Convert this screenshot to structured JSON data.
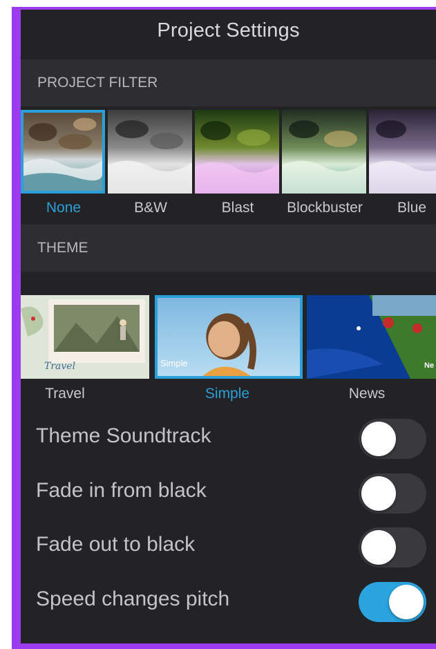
{
  "header": {
    "title": "Project Settings"
  },
  "project_filter": {
    "section_title": "PROJECT FILTER",
    "filters": [
      {
        "label": "None",
        "selected": true
      },
      {
        "label": "B&W",
        "selected": false
      },
      {
        "label": "Blast",
        "selected": false
      },
      {
        "label": "Blockbuster",
        "selected": false
      },
      {
        "label": "Blue",
        "selected": false
      }
    ]
  },
  "theme": {
    "section_title": "THEME",
    "themes": [
      {
        "label": "Travel",
        "selected": false,
        "thumb_text": "Travel"
      },
      {
        "label": "Simple",
        "selected": true,
        "thumb_text": "Simple"
      },
      {
        "label": "News",
        "selected": false,
        "thumb_text": "Ne"
      }
    ]
  },
  "settings": [
    {
      "label": "Theme Soundtrack",
      "on": false
    },
    {
      "label": "Fade in from black",
      "on": false
    },
    {
      "label": "Fade out to black",
      "on": false
    },
    {
      "label": "Speed changes pitch",
      "on": true
    }
  ],
  "colors": {
    "accent": "#2a9fd8",
    "background": "#232326",
    "section_background": "#2e2e32",
    "frame": "#9b3cf0",
    "switch_off": "#3a3a3e",
    "switch_on": "#2aa3de"
  }
}
